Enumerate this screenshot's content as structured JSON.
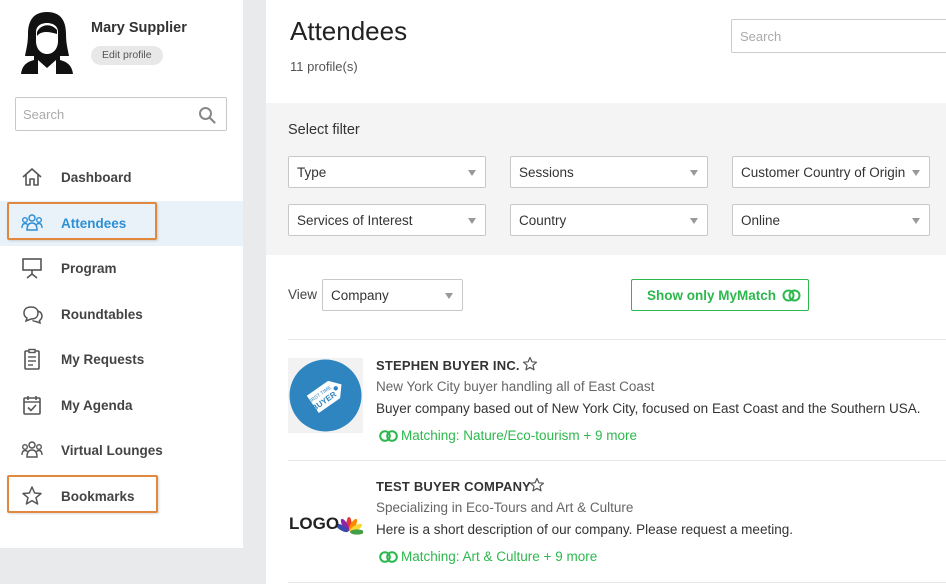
{
  "profile": {
    "name": "Mary Supplier",
    "edit_label": "Edit profile"
  },
  "sidebar_search": {
    "placeholder": "Search"
  },
  "nav": [
    {
      "label": "Dashboard",
      "icon": "home-icon"
    },
    {
      "label": "Attendees",
      "icon": "people-icon",
      "active": true
    },
    {
      "label": "Program",
      "icon": "presentation-icon"
    },
    {
      "label": "Roundtables",
      "icon": "chat-bubbles-icon"
    },
    {
      "label": "My Requests",
      "icon": "clipboard-icon"
    },
    {
      "label": "My Agenda",
      "icon": "calendar-check-icon"
    },
    {
      "label": "Virtual Lounges",
      "icon": "people-icon"
    },
    {
      "label": "Bookmarks",
      "icon": "star-icon"
    }
  ],
  "page": {
    "title": "Attendees",
    "count": "11 profile(s)"
  },
  "top_search": {
    "placeholder": "Search"
  },
  "filters": {
    "title": "Select filter",
    "selects": [
      "Type",
      "Sessions",
      "Customer Country of Origin",
      "Services of Interest",
      "Country",
      "Online"
    ]
  },
  "view": {
    "label": "View",
    "selected": "Company"
  },
  "mymatch": {
    "label": "Show only MyMatch"
  },
  "cards": [
    {
      "company": "STEPHEN BUYER INC.",
      "tagline": "New York City buyer handling all of East Coast",
      "desc": "Buyer company based out of New York City, focused on East Coast and the Southern USA.",
      "matching": "Matching: Nature/Eco-tourism + 9 more",
      "logo_text": "FIRST TIME BUYER"
    },
    {
      "company": "TEST BUYER COMPANY",
      "tagline": "Specializing in Eco-Tours and Art & Culture",
      "desc": "Here is a short description of our company. Please request a meeting.",
      "matching": "Matching: Art & Culture + 9 more",
      "logo_text": "LOGO"
    }
  ],
  "colors": {
    "accent_blue": "#2e8fd6",
    "match_green": "#2db84d",
    "highlight_orange": "#e0883e"
  }
}
